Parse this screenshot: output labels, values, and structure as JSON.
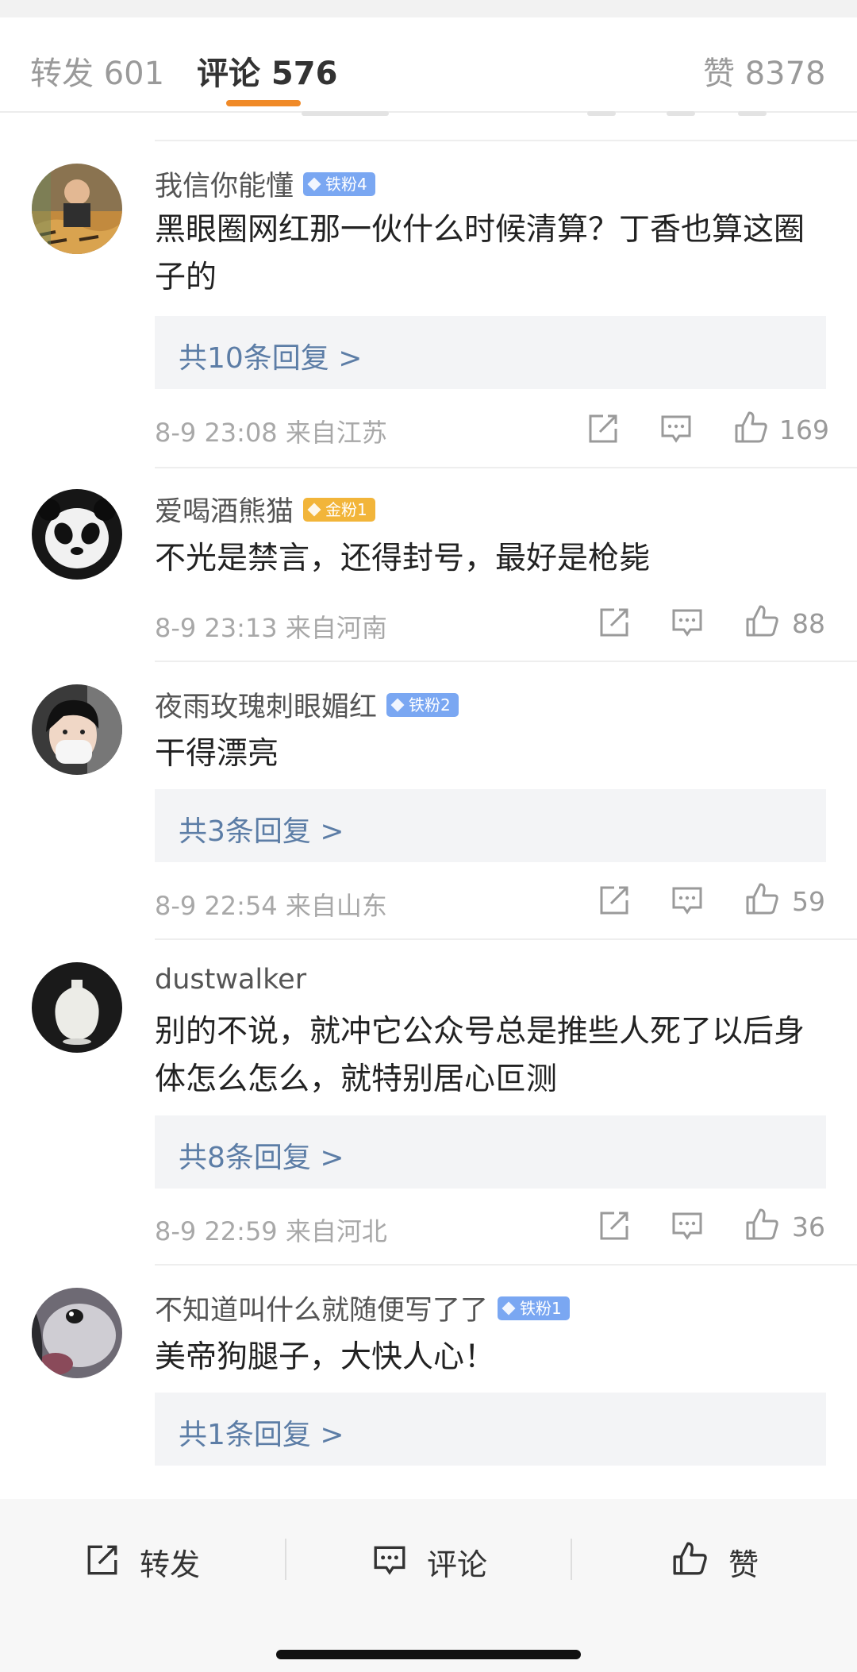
{
  "tabs": {
    "repost": "转发 601",
    "comments": "评论 576",
    "likes": "赞 8378"
  },
  "comments": [
    {
      "username": "我信你能懂",
      "badge": "铁粉4",
      "badge_type": "iron",
      "text": "黑眼圈网红那一伙什么时候清算？丁香也算这圈子的",
      "replies": "共10条回复 >",
      "time": "8-9 23:08",
      "location": "来自江苏",
      "likes": "169"
    },
    {
      "username": "爱喝酒熊猫",
      "badge": "金粉1",
      "badge_type": "gold",
      "text": "不光是禁言，还得封号，最好是枪毙",
      "time": "8-9 23:13",
      "location": "来自河南",
      "likes": "88"
    },
    {
      "username": "夜雨玫瑰刺眼媚红",
      "badge": "铁粉2",
      "badge_type": "iron",
      "text": "干得漂亮",
      "replies": "共3条回复 >",
      "time": "8-9 22:54",
      "location": "来自山东",
      "likes": "59"
    },
    {
      "username": "dustwalker",
      "text": "别的不说，就冲它公众号总是推些人死了以后身体怎么怎么，就特别居心叵测",
      "replies": "共8条回复 >",
      "time": "8-9 22:59",
      "location": "来自河北",
      "likes": "36"
    },
    {
      "username": "不知道叫什么就随便写了了",
      "badge": "铁粉1",
      "badge_type": "iron",
      "text": "美帝狗腿子，大快人心！",
      "replies": "共1条回复 >"
    }
  ],
  "bottom": {
    "repost": "转发",
    "comment": "评论",
    "like": "赞"
  },
  "colors": {
    "accent": "#f08a28",
    "link": "#5c7da6",
    "iron_badge": "#7aa7f2",
    "gold_badge": "#f2b53a"
  },
  "icons": [
    "share-icon",
    "comment-icon",
    "like-icon"
  ]
}
